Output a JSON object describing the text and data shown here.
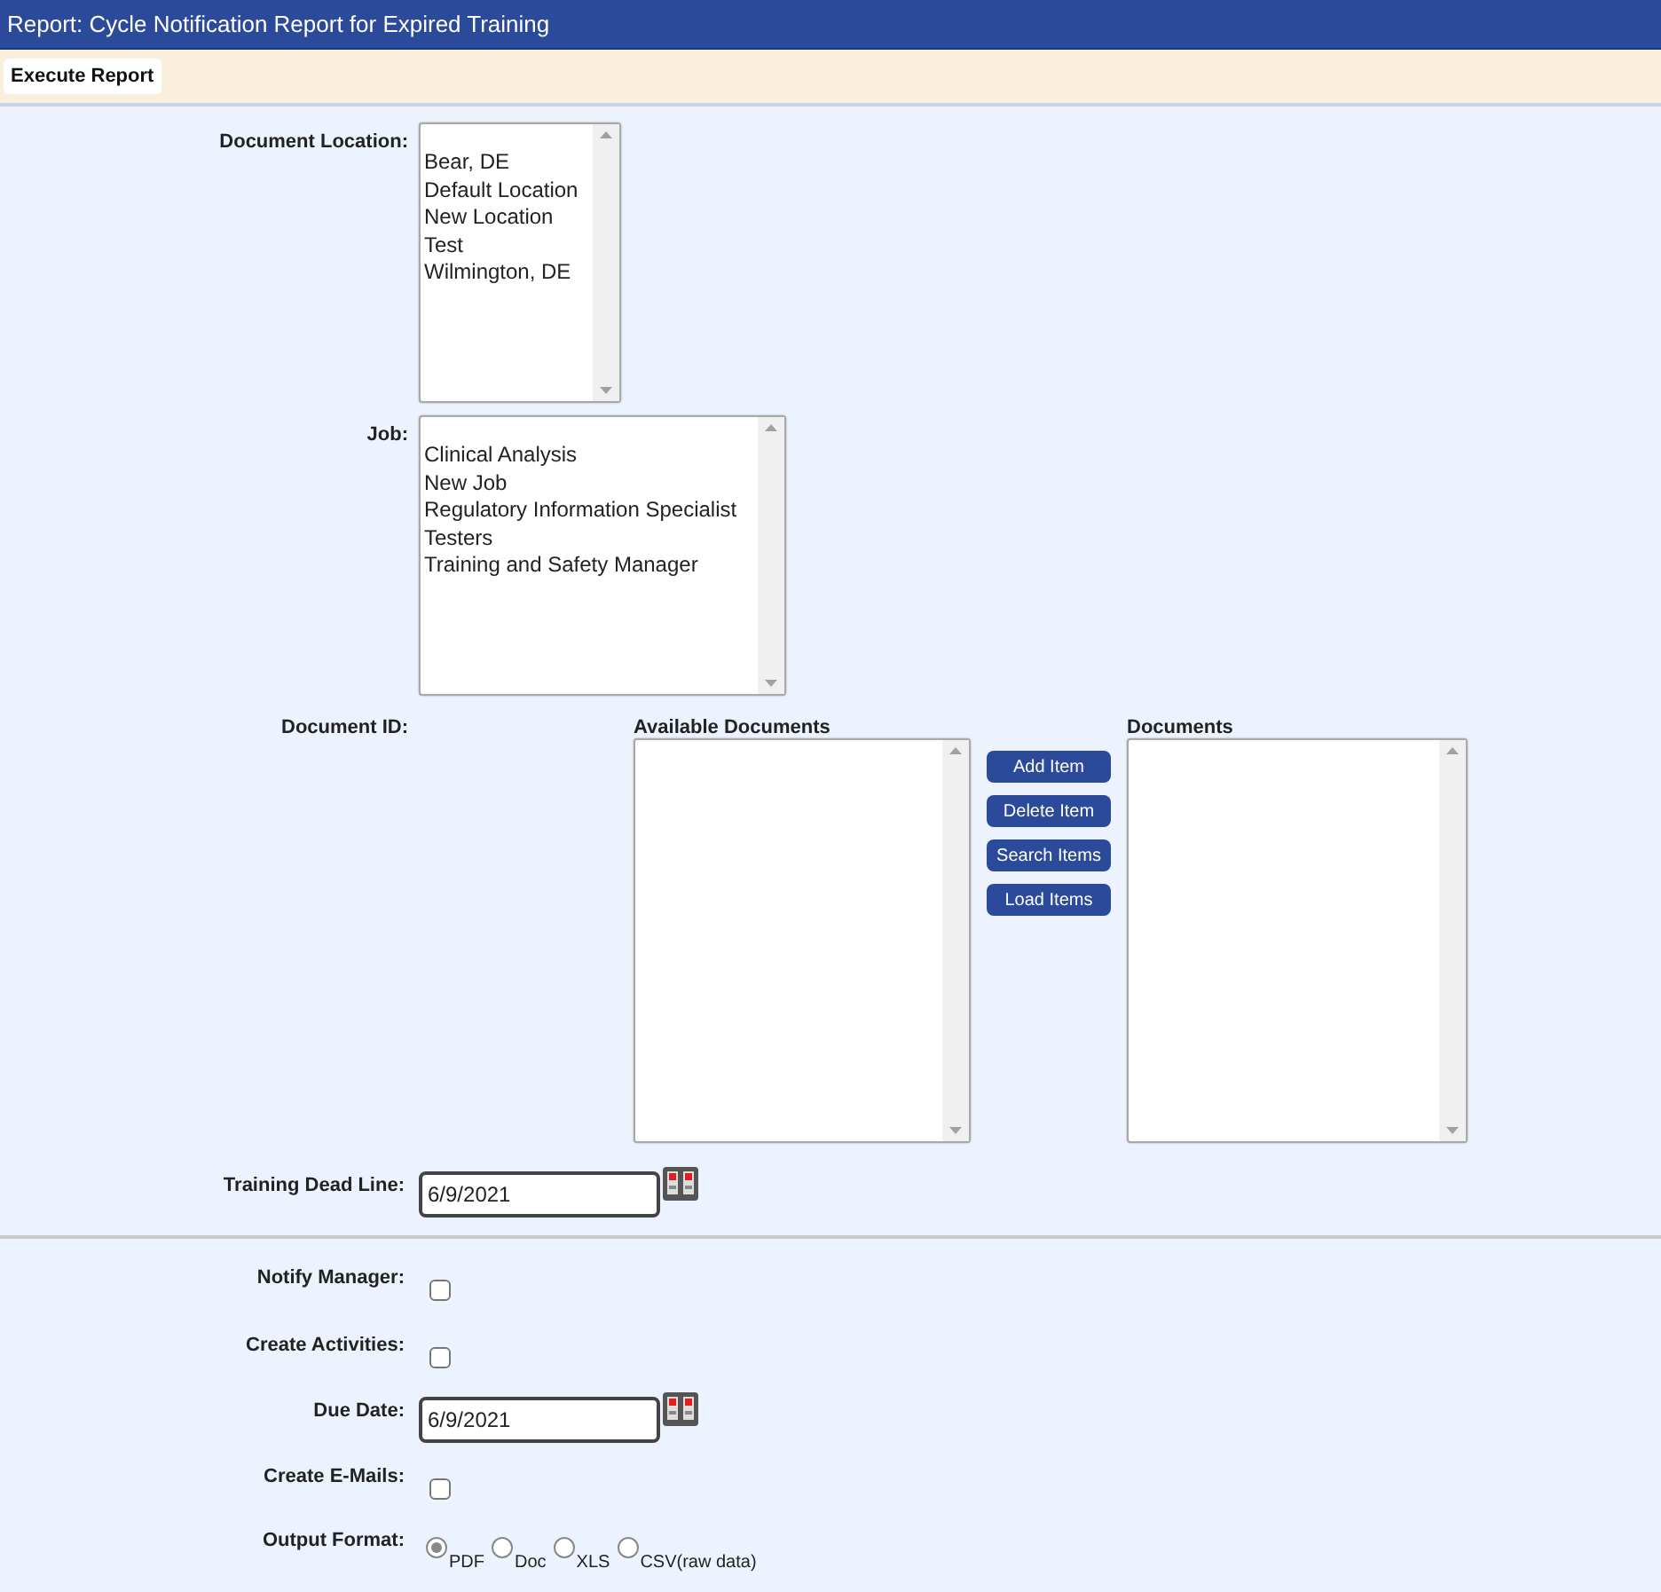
{
  "window": {
    "title": "Report: Cycle Notification Report for Expired Training"
  },
  "toolbar": {
    "buttons": [
      "Execute Report"
    ]
  },
  "document_location": {
    "label": "Document Location:",
    "options": [
      "Bear, DE",
      "Default Location",
      "New Location",
      "Test",
      "Wilmington, DE"
    ]
  },
  "job": {
    "label": "Job:",
    "options": [
      "Clinical Analysis",
      "New Job",
      "Regulatory Information Specialist",
      "Testers",
      "Training and Safety Manager"
    ]
  },
  "document_id": {
    "label": "Document ID:",
    "available_label": "Available Documents",
    "selected_label": "Documents",
    "buttons": [
      "Add Item",
      "Delete Item",
      "Search Items",
      "Load Items"
    ]
  },
  "training_dead_line": {
    "label": "Training Dead Line:",
    "value": "6/9/2021"
  },
  "options": [
    {
      "kind": "checkbox",
      "label": "Notify Manager:",
      "checked": false
    },
    {
      "kind": "checkbox",
      "label": "Create Activities:",
      "checked": false
    },
    {
      "kind": "date",
      "label": "Due Date:",
      "value": "6/9/2021"
    },
    {
      "kind": "checkbox",
      "label": "Create E-Mails:",
      "checked": false
    },
    {
      "kind": "radio",
      "label": "Output Format:",
      "choices": [
        {
          "label": "PDF",
          "selected": true
        },
        {
          "label": "Doc",
          "selected": false
        },
        {
          "label": "XLS",
          "selected": false
        },
        {
          "label": "CSV(raw data)",
          "selected": false
        }
      ]
    }
  ]
}
